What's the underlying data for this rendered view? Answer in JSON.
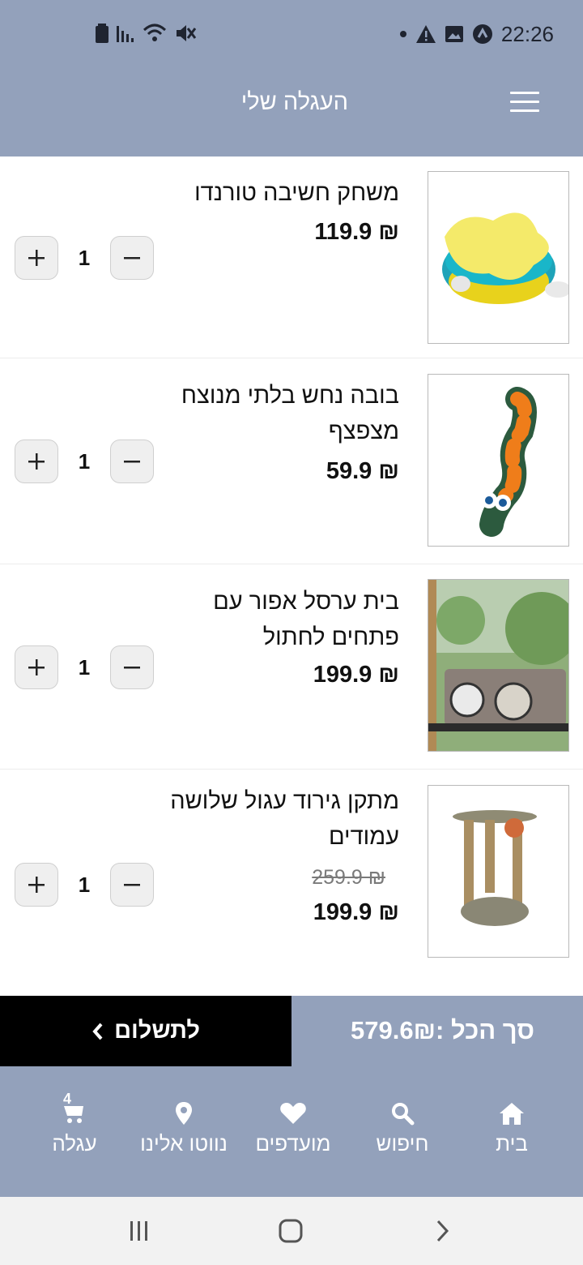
{
  "status_bar": {
    "time": "22:26"
  },
  "header": {
    "title": "העגלה שלי"
  },
  "items": [
    {
      "name": "משחק חשיבה טורנדו",
      "price": "119.9 ₪",
      "old_price": "",
      "quantity": "1"
    },
    {
      "name": "בובה נחש בלתי מנוצח מצפצף",
      "price": "59.9 ₪",
      "old_price": "",
      "quantity": "1"
    },
    {
      "name": "בית ערסל אפור עם פתחים לחתול",
      "price": "199.9 ₪",
      "old_price": "",
      "quantity": "1"
    },
    {
      "name": "מתקן גירוד עגול שלושה עמודים",
      "price": "199.9 ₪",
      "old_price": "259.9 ₪",
      "quantity": "1"
    }
  ],
  "checkout": {
    "pay_label": "לתשלום",
    "total": "סך הכל :579.6₪"
  },
  "bottom_nav": {
    "home": "בית",
    "search": "חיפוש",
    "favorites": "מועדפים",
    "navigate": "נווטו אלינו",
    "cart": "עגלה",
    "cart_count": "4"
  },
  "colors": {
    "bar": "#93a1bb",
    "pay_button": "#000000"
  }
}
